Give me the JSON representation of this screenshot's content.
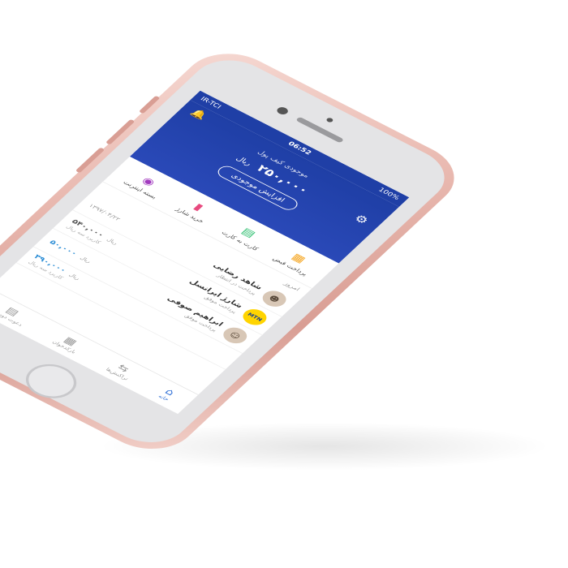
{
  "status_bar": {
    "carrier": "IR-TCI",
    "time": "06:52",
    "battery": "100%"
  },
  "hero": {
    "balance_label": "موجودی کیف پول",
    "balance_amount": "۲۵۰,۰۰۰",
    "currency": "ریال",
    "topup_label": "افزایش موجودی",
    "bell_icon": "bell-icon",
    "settings_icon": "gear-icon"
  },
  "actions": [
    {
      "label": "پرداخت قبض",
      "icon": "bill-icon"
    },
    {
      "label": "کارت به کارت",
      "icon": "card-icon"
    },
    {
      "label": "خرید شارژ",
      "icon": "sim-charge-icon"
    },
    {
      "label": "بسته اینترنت",
      "icon": "signal-icon"
    }
  ],
  "today_label": "امروز",
  "transactions": [
    {
      "name": "شاهد رضایی",
      "sub": "پرداخت در انتظار",
      "amount": "",
      "currency": "",
      "date": "۱۳۹۷/۰۴/۲۲",
      "note": "",
      "avatar": "avatar-photo"
    },
    {
      "name": "شارژ ایرانسل",
      "sub": "پرداخت موفق",
      "amount": "۵۴۰,۰۰۰",
      "currency": "ریال",
      "date": "",
      "note": "کاربرد سه ریال",
      "avatar": "MTN",
      "amount_color": "gray"
    },
    {
      "name": "ابراهیم صوفی",
      "sub": "پرداخت موفق",
      "amount": "۵۰,۰۰۰",
      "currency": "ریال",
      "date": "",
      "note": "",
      "avatar": "avatar-photo",
      "amount_color": "blue"
    },
    {
      "name": "",
      "sub": "",
      "amount": "۳۹۰,۰۰۰",
      "currency": "ریال",
      "date": "",
      "note": "کاربرد سه ریال",
      "avatar": "",
      "amount_color": "blue"
    }
  ],
  "tabbar": [
    {
      "label": "خانه",
      "icon": "home-icon",
      "active": true
    },
    {
      "label": "تراکنش‌ها",
      "icon": "transactions-icon",
      "active": false
    },
    {
      "label": "بارکدخوان",
      "icon": "qr-scan-icon",
      "active": false
    },
    {
      "label": "دعوت دوستان",
      "icon": "gift-icon",
      "active": false
    }
  ],
  "colors": {
    "primary": "#1f3fa6",
    "accent_blue": "#2f8fd6",
    "phone_rose_gold": "#e9b9b0",
    "bill": "#f5a623",
    "card": "#2fbf71",
    "charge": "#e84a7f",
    "internet": "#a23bbf"
  }
}
